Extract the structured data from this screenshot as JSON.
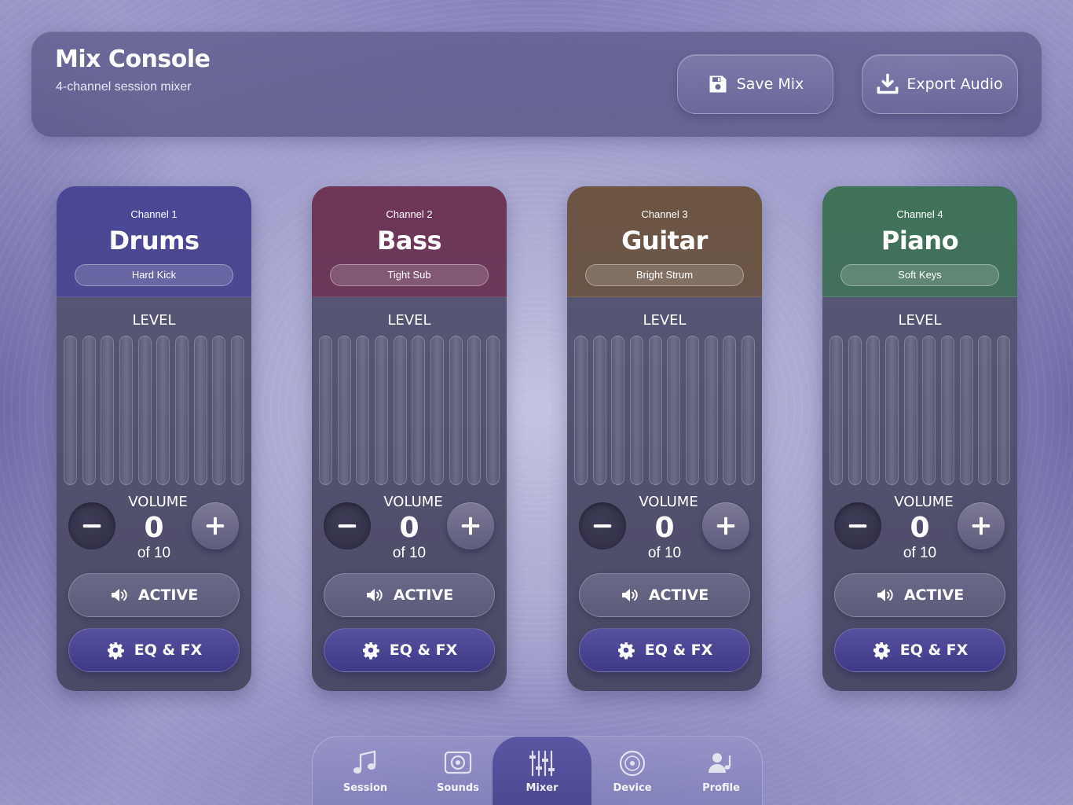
{
  "header": {
    "title": "Mix Console",
    "subtitle": "4-channel session mixer",
    "save_label": "Save Mix",
    "save_icon": "save-icon",
    "export_label": "Export Audio",
    "export_icon": "download-icon"
  },
  "channels": [
    {
      "label": "Channel 1",
      "name": "Drums",
      "preset": "Hard Kick",
      "accent": "#4a4796",
      "level_label": "LEVEL",
      "volume_label": "VOLUME",
      "volume_value": "0",
      "volume_of": "of 10",
      "active_label": "ACTIVE",
      "eq_label": "EQ & FX"
    },
    {
      "label": "Channel 2",
      "name": "Bass",
      "preset": "Tight Sub",
      "accent": "#6e3556",
      "level_label": "LEVEL",
      "volume_label": "VOLUME",
      "volume_value": "0",
      "volume_of": "of 10",
      "active_label": "ACTIVE",
      "eq_label": "EQ & FX"
    },
    {
      "label": "Channel 3",
      "name": "Guitar",
      "preset": "Bright Strum",
      "accent": "#6d5541",
      "level_label": "LEVEL",
      "volume_label": "VOLUME",
      "volume_value": "0",
      "volume_of": "of 10",
      "active_label": "ACTIVE",
      "eq_label": "EQ & FX"
    },
    {
      "label": "Channel 4",
      "name": "Piano",
      "preset": "Soft Keys",
      "accent": "#3f7358",
      "level_label": "LEVEL",
      "volume_label": "VOLUME",
      "volume_value": "0",
      "volume_of": "of 10",
      "active_label": "ACTIVE",
      "eq_label": "EQ & FX"
    }
  ],
  "nav": {
    "items": [
      {
        "label": "Session",
        "icon": "music-note-icon"
      },
      {
        "label": "Sounds",
        "icon": "speaker-icon"
      },
      {
        "label": "Mixer",
        "icon": "sliders-icon",
        "selected": true
      },
      {
        "label": "Device",
        "icon": "disc-icon"
      },
      {
        "label": "Profile",
        "icon": "user-music-icon"
      }
    ]
  }
}
